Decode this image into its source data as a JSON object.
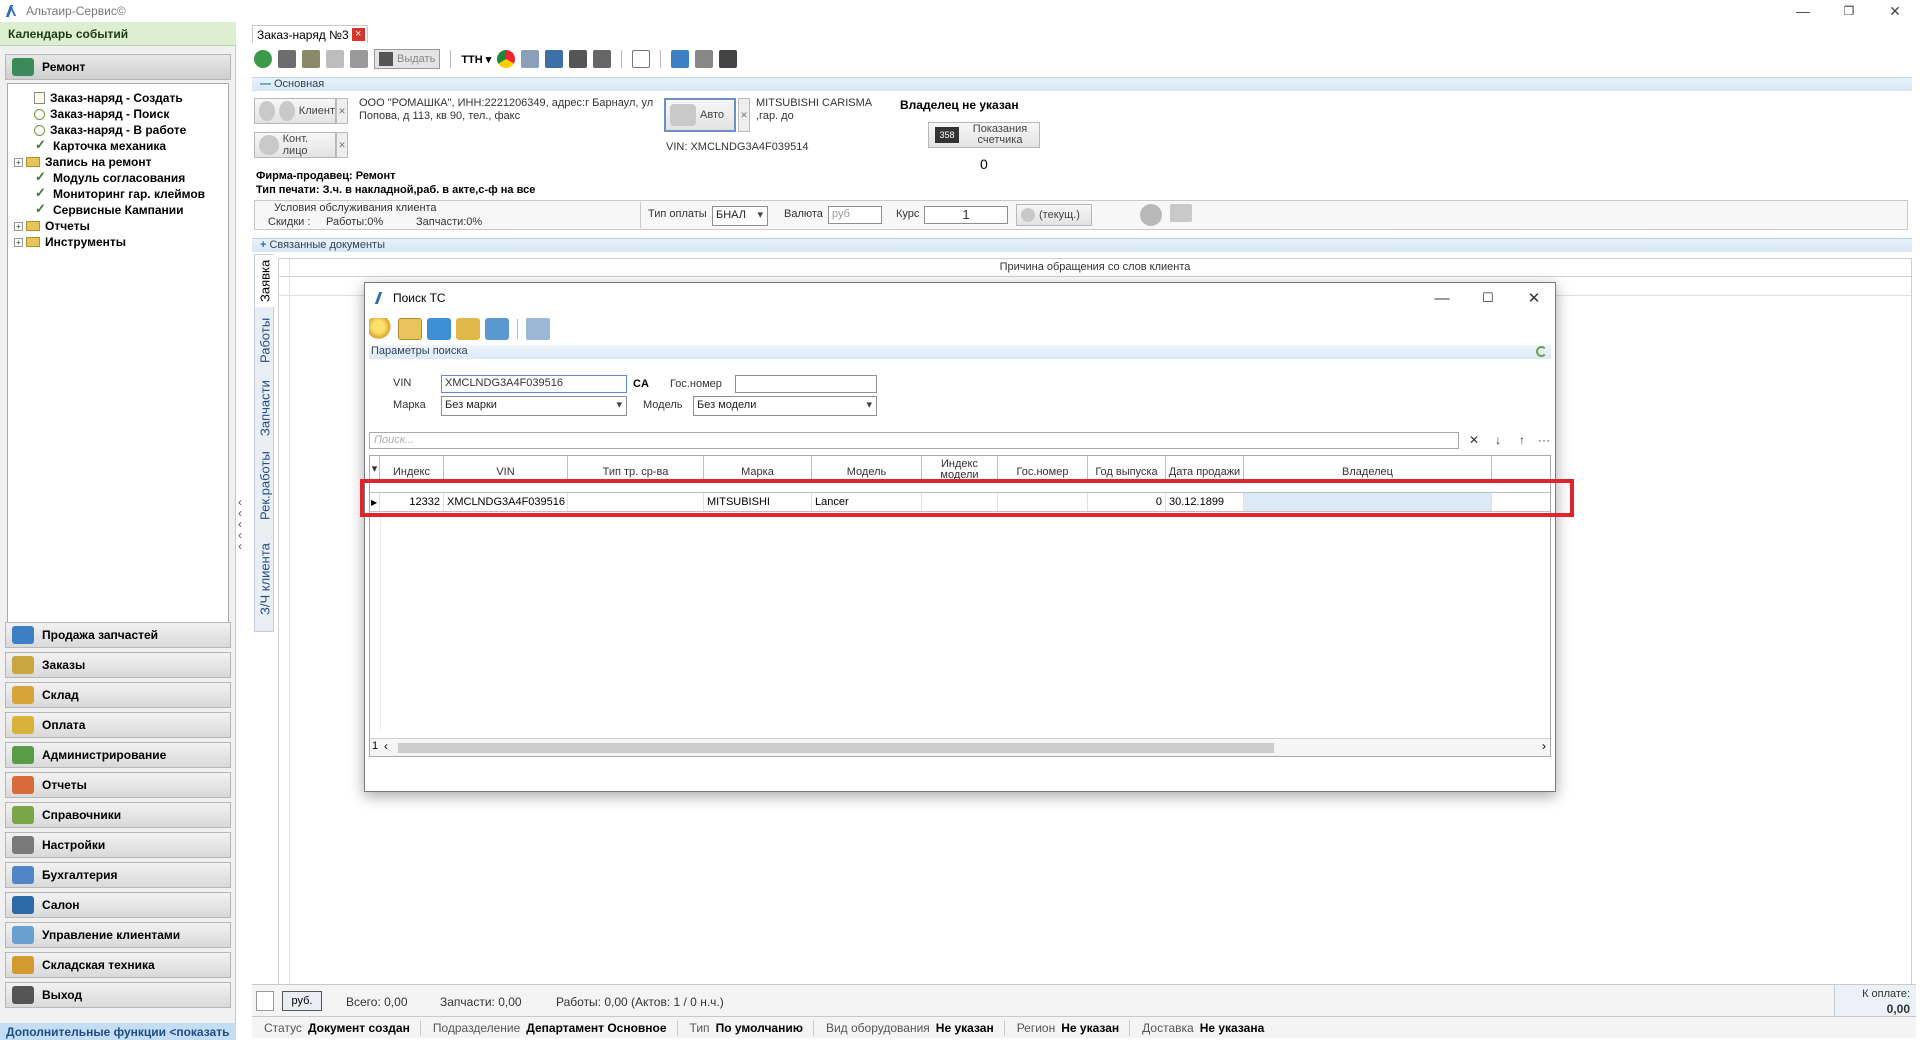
{
  "app": {
    "title": "Альтаир-Сервис©"
  },
  "left_panel": {
    "calendar": "Календарь событий",
    "active_section": "Ремонт",
    "tree": [
      {
        "label": "Заказ-наряд - Создать",
        "icon": "doc"
      },
      {
        "label": "Заказ-наряд - Поиск",
        "icon": "circle"
      },
      {
        "label": "Заказ-наряд - В работе",
        "icon": "circle"
      },
      {
        "label": "Карточка механика",
        "icon": "check"
      },
      {
        "label": "Запись на ремонт",
        "icon": "folder"
      },
      {
        "label": "Модуль согласования",
        "icon": "check"
      },
      {
        "label": "Мониторинг гар. клеймов",
        "icon": "check"
      },
      {
        "label": "Сервисные Кампании",
        "icon": "check"
      },
      {
        "label": "Отчеты",
        "icon": "folder"
      },
      {
        "label": "Инструменты",
        "icon": "folder"
      }
    ],
    "nav": [
      {
        "label": "Продажа запчастей",
        "color": "#3d7fc4"
      },
      {
        "label": "Заказы",
        "color": "#c9a640"
      },
      {
        "label": "Склад",
        "color": "#d6a43a"
      },
      {
        "label": "Оплата",
        "color": "#d9b23b"
      },
      {
        "label": "Администрирование",
        "color": "#5a9b48"
      },
      {
        "label": "Отчеты",
        "color": "#d96a3c"
      },
      {
        "label": "Справочники",
        "color": "#7aa64a"
      },
      {
        "label": "Настройки",
        "color": "#7a7a7a"
      },
      {
        "label": "Бухгалтерия",
        "color": "#4f86c6"
      },
      {
        "label": "Салон",
        "color": "#2f6aa8"
      },
      {
        "label": "Управление клиентами",
        "color": "#6aa0cf"
      },
      {
        "label": "Складская техника",
        "color": "#d29a2f"
      },
      {
        "label": "Выход",
        "color": "#555555"
      }
    ],
    "extra_functions": "Дополнительные функции <показать"
  },
  "document": {
    "tab_label": "Заказ-наряд №3",
    "toolbar_issue": "Выдать",
    "toolbar_tth": "ТТН",
    "section_main": "Основная",
    "client_btn": "Клиент",
    "client_info": "ООО \"РОМАШКА\", ИНН:2221206349, адрес:г Барнаул, ул Попова, д 113, кв 90, тел., факс",
    "contact_btn": "Конт. лицо",
    "auto_btn": "Авто",
    "auto_info": "MITSUBISHI CARISMA ,гар. до",
    "vin_line": "VIN: XMCLNDG3A4F039514",
    "owner": "Владелец  не указан",
    "odometer_label": "Показания счетчика",
    "odometer_value": "0",
    "seller": "Фирма-продавец: Ремонт",
    "print_type": "Тип печати: З.ч. в накладной,раб. в акте,с-ф на все",
    "conditions_title": "Условия обслуживания клиента",
    "discounts": "Скидки :",
    "works_disc": "Работы:0%",
    "parts_disc": "Запчасти:0%",
    "pay_type_label": "Тип оплаты",
    "pay_type": "БНАЛ",
    "currency_label": "Валюта",
    "currency": "руб",
    "rate_label": "Курс",
    "rate": "1",
    "rate_btn": "(текущ.)",
    "related_docs": "Связанные документы",
    "reason_header": "Причина обращения со слов клиента",
    "vtabs": [
      "Заявка",
      "Работы",
      "Запчасти",
      "Рек.работы",
      "З/Ч клиента"
    ],
    "footer": {
      "currency": "руб.",
      "total": "Всего: 0,00",
      "parts": "Запчасти: 0,00",
      "works": "Работы: 0,00 (Актов: 1 / 0 н.ч.)",
      "to_pay_label": "К оплате:",
      "to_pay": "0,00"
    },
    "status_bar": [
      {
        "label": "Статус",
        "value": "Документ создан"
      },
      {
        "label": "Подразделение",
        "value": "Департамент Основное"
      },
      {
        "label": "Тип",
        "value": "По умолчанию"
      },
      {
        "label": "Вид оборудования",
        "value": "Не указан"
      },
      {
        "label": "Регион",
        "value": "Не указан"
      },
      {
        "label": "Доставка",
        "value": "Не указана"
      }
    ]
  },
  "dialog": {
    "title": "Поиск ТС",
    "params_section": "Параметры поиска",
    "vin_label": "VIN",
    "vin_value": "XMCLNDG3A4F039516",
    "vin_suffix": "CA",
    "plate_label": "Гос.номер",
    "plate_value": "",
    "brand_label": "Марка",
    "brand_value": "Без марки",
    "model_label": "Модель",
    "model_value": "Без модели",
    "search_placeholder": "Поиск...",
    "columns": [
      "Индекс",
      "VIN",
      "Тип тр. ср-ва",
      "Марка",
      "Модель",
      "Индекс модели",
      "Гос.номер",
      "Год выпуска",
      "Дата продажи",
      "Владелец"
    ],
    "row": {
      "index": "12332",
      "vin": "XMCLNDG3A4F039516",
      "type": "",
      "brand": "MITSUBISHI",
      "model": "Lancer",
      "model_index": "",
      "plate": "",
      "year": "0",
      "sale_date": "30.12.1899",
      "owner": ""
    },
    "page": "1"
  },
  "colors": {
    "highlight": "#e0242e",
    "accent": "#2a6fb0"
  }
}
